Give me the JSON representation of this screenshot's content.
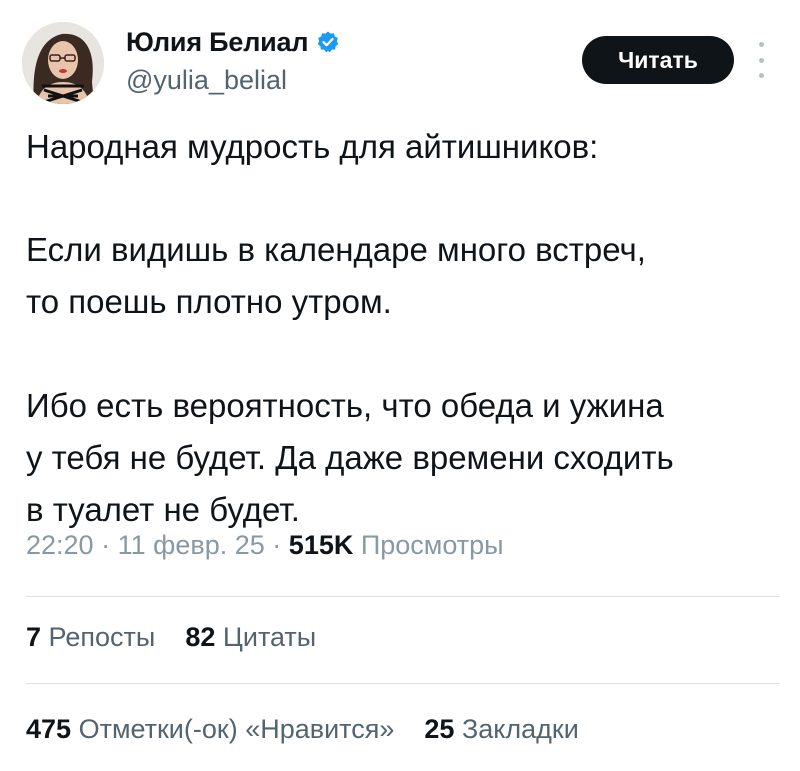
{
  "author": {
    "display_name": "Юлия Белиал",
    "handle": "@yulia_belial",
    "verified_icon": "verified-badge-icon",
    "avatar_icon": "avatar"
  },
  "follow_button": {
    "label": "Читать"
  },
  "more_icon": "more-vertical-icon",
  "tweet": {
    "line1": "Народная мудрость для айтишников:",
    "line2": "Если видишь в календаре много встреч,",
    "line3": "то поешь плотно утром.",
    "line4": "Ибо есть вероятность, что обеда и ужина",
    "line5": "у тебя не будет. Да даже времени сходить",
    "line6": "в туалет не будет."
  },
  "meta": {
    "time": "22:20",
    "separator": "·",
    "date": "11 февр. 25",
    "views_count": "515K",
    "views_label": "Просмотры"
  },
  "stats": {
    "reposts_count": "7",
    "reposts_label": "Репосты",
    "quotes_count": "82",
    "quotes_label": "Цитаты",
    "likes_count": "475",
    "likes_label": "Отметки(-ок) «Нравится»",
    "bookmarks_count": "25",
    "bookmarks_label": "Закладки"
  },
  "colors": {
    "text_primary": "#0f1419",
    "text_secondary": "#536471",
    "meta_text": "#8899a6",
    "verified_blue": "#1d9bf0",
    "button_bg": "#0f1419",
    "divider": "#dfe3e6"
  }
}
